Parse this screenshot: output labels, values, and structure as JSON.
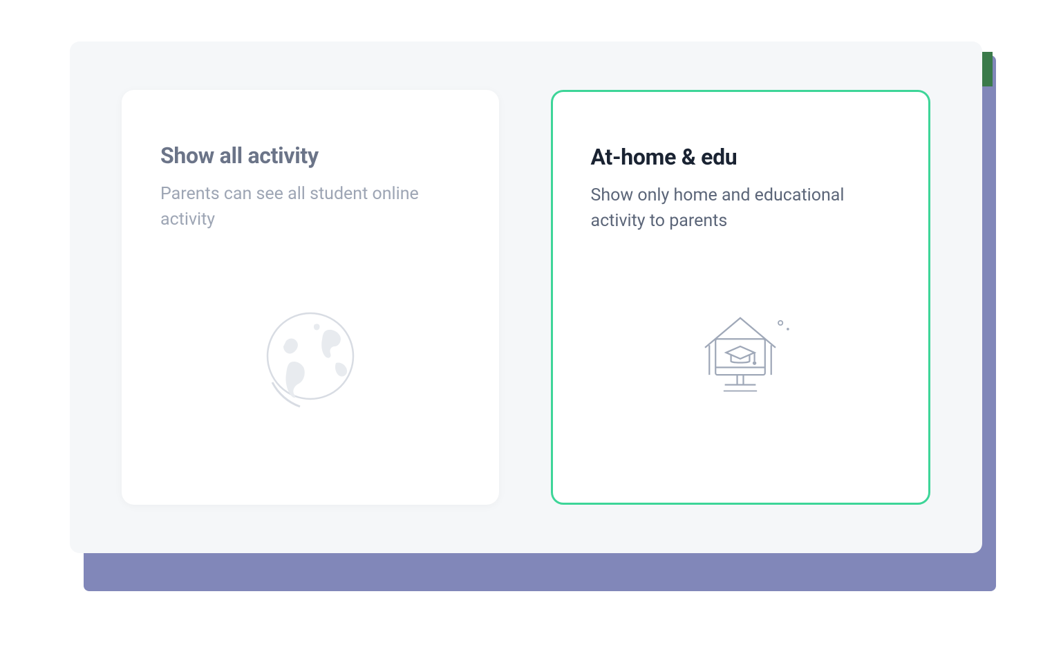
{
  "options": {
    "all_activity": {
      "title": "Show all activity",
      "description": "Parents can see all student online activity",
      "selected": false
    },
    "at_home_edu": {
      "title": "At-home & edu",
      "description": "Show only home and educational activity to parents",
      "selected": true
    }
  },
  "colors": {
    "accent_selected": "#3dd598",
    "shadow_panel": "#8187b9",
    "panel_bg": "#f5f7f9"
  }
}
